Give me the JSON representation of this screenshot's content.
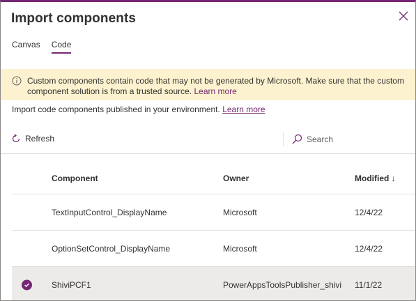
{
  "dialog": {
    "title": "Import components",
    "tabs": [
      {
        "label": "Canvas",
        "active": false
      },
      {
        "label": "Code",
        "active": true
      }
    ]
  },
  "banner": {
    "text": "Custom components contain code that may not be generated by Microsoft. Make sure that the custom component solution is from a trusted source.",
    "link": "Learn more"
  },
  "description": {
    "text": "Import code components published in your environment.",
    "link": "Learn more"
  },
  "toolbar": {
    "refresh_label": "Refresh",
    "search_placeholder": "Search"
  },
  "table": {
    "columns": {
      "component": "Component",
      "owner": "Owner",
      "modified": "Modified",
      "sort_indicator": "↓"
    },
    "rows": [
      {
        "component": "TextInputControl_DisplayName",
        "owner": "Microsoft",
        "modified": "12/4/22",
        "selected": false
      },
      {
        "component": "OptionSetControl_DisplayName",
        "owner": "Microsoft",
        "modified": "12/4/22",
        "selected": false
      },
      {
        "component": "ShiviPCF1",
        "owner": "PowerAppsToolsPublisher_shivi",
        "modified": "11/1/22",
        "selected": true
      }
    ]
  },
  "colors": {
    "accent": "#742774",
    "banner_bg": "#fcf2cf",
    "selected_row": "#edebe9"
  }
}
